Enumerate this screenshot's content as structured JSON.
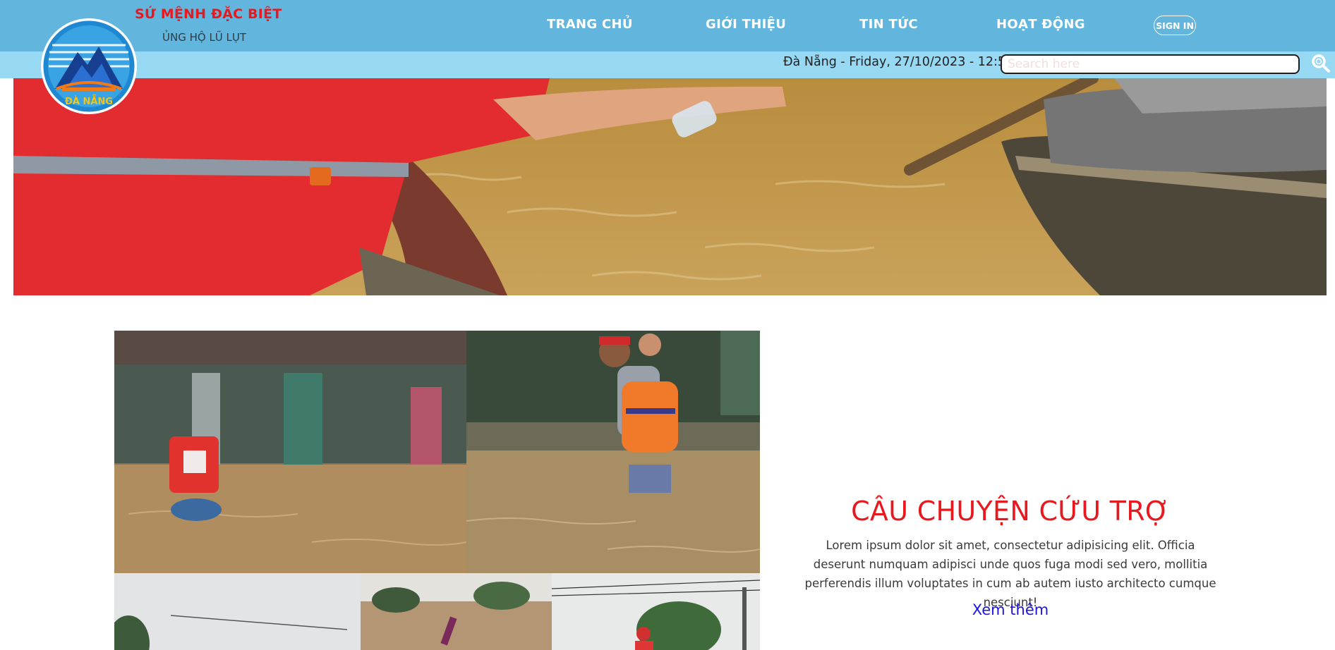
{
  "brand": {
    "title": "SỨ MỆNH ĐẶC BIỆT",
    "subtitle": "ỦNG HỘ LŨ LỤT",
    "logo_text": "ĐÀ NẴNG",
    "logo_icon": "mountain-bridge-logo-icon"
  },
  "nav": {
    "items": [
      {
        "label": "TRANG CHỦ"
      },
      {
        "label": "GIỚI THIỆU"
      },
      {
        "label": "TIN TỨC"
      },
      {
        "label": "HOẠT ĐỘNG"
      }
    ],
    "signin_label": "SIGN IN"
  },
  "subbar": {
    "datetime": "Đà Nẵng - Friday, 27/10/2023 - 12:50",
    "search_placeholder": "Search here",
    "search_icon": "search-icon"
  },
  "story": {
    "title": "CÂU CHUYỆN CỨU TRỢ",
    "text": "Lorem ipsum dolor sit amet, consectetur adipisicing elit. Officia deserunt numquam adipisci unde quos fuga modi sed vero, mollitia perferendis illum voluptates in cum ab autem iusto architecto cumque nesciunt!",
    "more_label": "Xem thêm"
  },
  "colors": {
    "topbar": "#62b6dd",
    "subbar": "#97d8f3",
    "brand_red": "#e8191e",
    "link_blue": "#1a14e6"
  }
}
